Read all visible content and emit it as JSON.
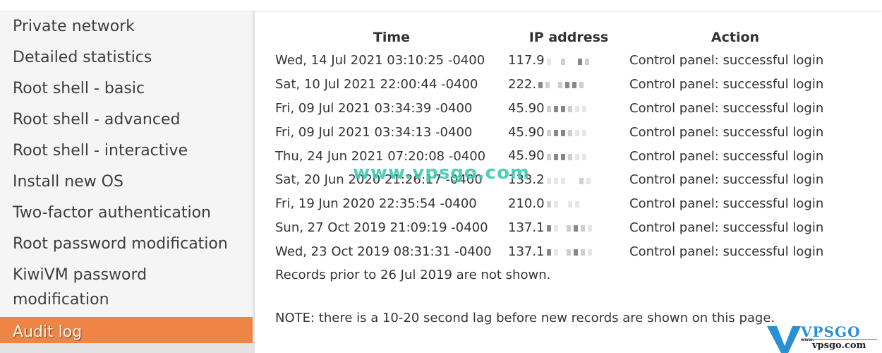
{
  "sidebar": {
    "items": [
      {
        "label": "Private network"
      },
      {
        "label": "Detailed statistics"
      },
      {
        "label": "Root shell - basic"
      },
      {
        "label": "Root shell - advanced"
      },
      {
        "label": "Root shell - interactive"
      },
      {
        "label": "Install new OS"
      },
      {
        "label": "Two-factor authentication"
      },
      {
        "label": "Root password modification"
      },
      {
        "label": "KiwiVM password modification"
      },
      {
        "label": "Audit log",
        "active": true
      }
    ],
    "active_color": "#ef8544"
  },
  "audit_log": {
    "columns": [
      "Time",
      "IP address",
      "Action"
    ],
    "rows": [
      {
        "time": "Wed, 14 Jul 2021 03:10:25 -0400",
        "ip": "117.9",
        "action": "Control panel: successful login"
      },
      {
        "time": "Sat, 10 Jul 2021 22:00:44 -0400",
        "ip": "222.",
        "action": "Control panel: successful login"
      },
      {
        "time": "Fri, 09 Jul 2021 03:34:39 -0400",
        "ip": "45.90",
        "action": "Control panel: successful login"
      },
      {
        "time": "Fri, 09 Jul 2021 03:34:13 -0400",
        "ip": "45.90",
        "action": "Control panel: successful login"
      },
      {
        "time": "Thu, 24 Jun 2021 07:20:08 -0400",
        "ip": "45.90",
        "action": "Control panel: successful login"
      },
      {
        "time": "Sat, 20 Jun 2020 21:26:17 -0400",
        "ip": "133.2",
        "action": "Control panel: successful login"
      },
      {
        "time": "Fri, 19 Jun 2020 22:35:54 -0400",
        "ip": "210.0",
        "action": "Control panel: successful login"
      },
      {
        "time": "Sun, 27 Oct 2019 21:09:19 -0400",
        "ip": "137.1",
        "action": "Control panel: successful login"
      },
      {
        "time": "Wed, 23 Oct 2019 08:31:31 -0400",
        "ip": "137.1",
        "action": "Control panel: successful login"
      }
    ],
    "records_note": "Records prior to 26 Jul 2019 are not shown.",
    "lag_note": "NOTE: there is a 10-20 second lag before new records are shown on this page."
  },
  "watermark": {
    "text": "www.vpsgo.com",
    "color": "#3ec9b0"
  },
  "logo": {
    "brand": "VPSGO",
    "www": "www.",
    "domain": "vpsgo.com",
    "color": "#2a8fd4"
  }
}
